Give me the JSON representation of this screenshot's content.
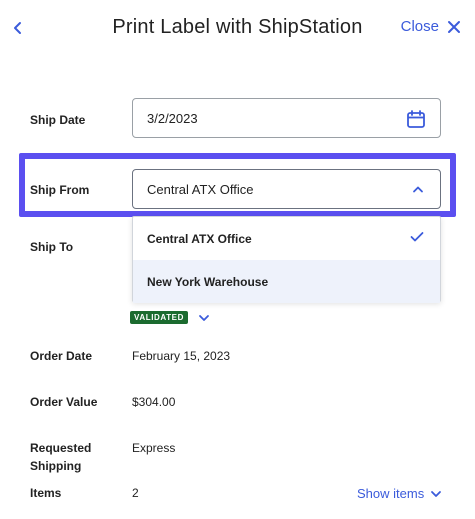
{
  "header": {
    "title": "Print Label with ShipStation",
    "close_label": "Close"
  },
  "form": {
    "ship_date": {
      "label": "Ship Date",
      "value": "3/2/2023"
    },
    "ship_from": {
      "label": "Ship From",
      "selected": "Central ATX Office",
      "options": [
        "Central ATX Office",
        "New York Warehouse"
      ]
    },
    "ship_to": {
      "label": "Ship To",
      "status_badge": "VALIDATED"
    },
    "order_date": {
      "label": "Order Date",
      "value": "February 15, 2023"
    },
    "order_value": {
      "label": "Order Value",
      "value": "$304.00"
    },
    "requested_shipping": {
      "label_line1": "Requested",
      "label_line2": "Shipping",
      "value": "Express"
    },
    "items": {
      "label": "Items",
      "value": "2",
      "show_items_label": "Show items"
    }
  },
  "colors": {
    "accent": "#3b5bdb",
    "highlight": "#5b4ff0",
    "badge_bg": "#1b6b2f",
    "option_hover": "#eef2fb"
  },
  "icons": {
    "back": "chevron-left-icon",
    "close": "close-icon",
    "calendar": "calendar-icon",
    "select": "chevron-up-icon",
    "selected": "check-icon",
    "expand": "chevron-down-icon"
  }
}
